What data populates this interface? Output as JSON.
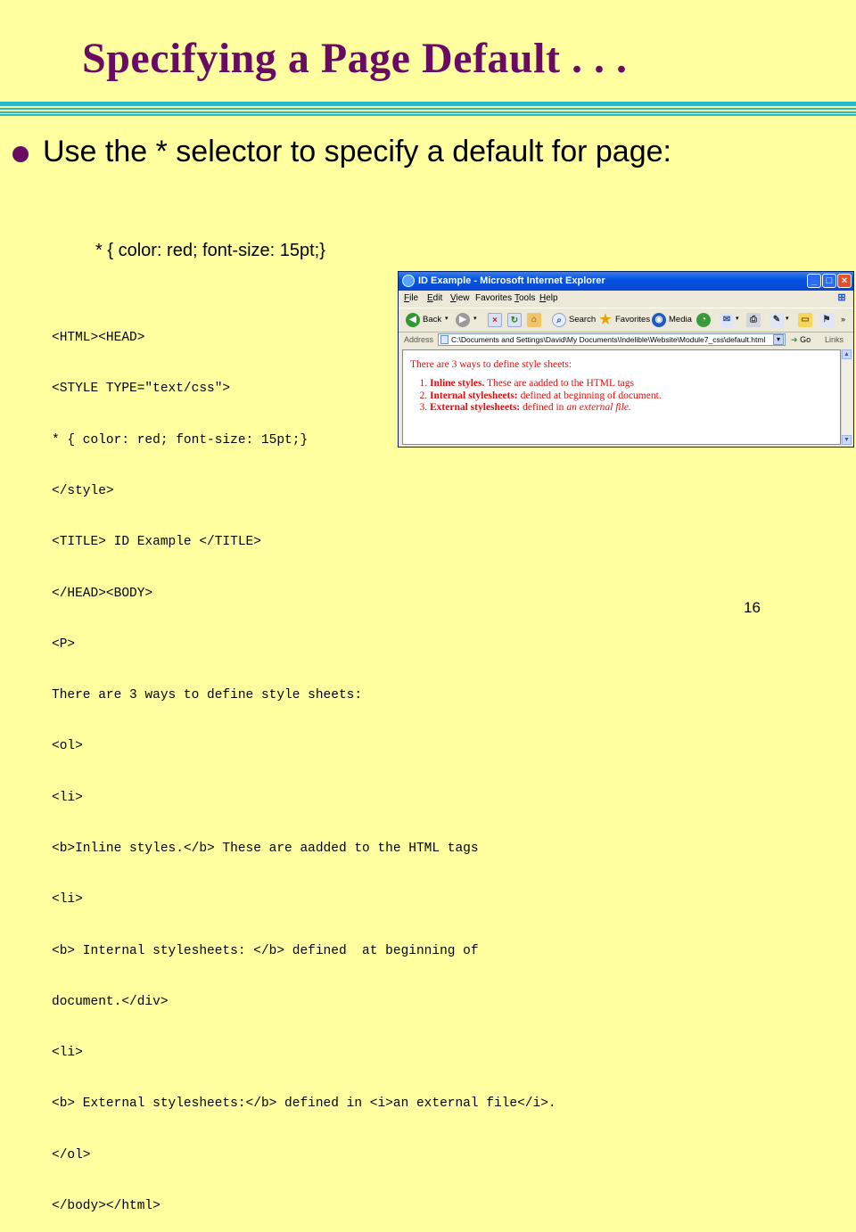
{
  "slide": {
    "title": "Specifying a Page Default . . .",
    "bullet": "Use the * selector to specify a default for page:",
    "selector_example": "* { color: red; font-size: 15pt;}",
    "code_lines": [
      "<HTML><HEAD>",
      "<STYLE TYPE=\"text/css\">",
      "* { color: red; font-size: 15pt;}",
      "</style>",
      "<TITLE> ID Example </TITLE>",
      "</HEAD><BODY>",
      "<P>",
      "There are 3 ways to define style sheets:",
      "<ol>",
      "<li>",
      "<b>Inline styles.</b> These are aadded to the HTML tags",
      "<li>",
      "<b> Internal stylesheets: </b> defined  at beginning of",
      "document.</div>",
      "<li>",
      "<b> External stylesheets:</b> defined in <i>an external file</i>.",
      "</ol>",
      "</body></html>"
    ],
    "page_number": "16"
  },
  "browser": {
    "window_title": "ID Example - Microsoft Internet Explorer",
    "menu": [
      {
        "u": "F",
        "rest": "ile"
      },
      {
        "u": "E",
        "rest": "dit"
      },
      {
        "u": "V",
        "rest": "iew"
      },
      {
        "u": "",
        "rest": "Favorites"
      },
      {
        "u": "T",
        "rest": "ools"
      },
      {
        "u": "H",
        "rest": "elp"
      }
    ],
    "toolbar": {
      "back": "Back",
      "search": "Search",
      "favorites": "Favorites",
      "media": "Media"
    },
    "address_label": "Address",
    "address_value": "C:\\Documents and Settings\\David\\My Documents\\Indelible\\Website\\Module7_css\\default.html",
    "go_label": "Go",
    "links_label": "Links",
    "content": {
      "paragraph": "There are 3 ways to define style sheets:",
      "items": [
        {
          "bold": "Inline styles.",
          "text": " These are aadded to the HTML tags",
          "italic": ""
        },
        {
          "bold": "Internal stylesheets:",
          "text": " defined at beginning of document.",
          "italic": ""
        },
        {
          "bold": "External stylesheets:",
          "text": " defined in ",
          "italic": "an external file."
        }
      ],
      "color": "#e01010"
    }
  },
  "colors": {
    "background": "#ffffa0",
    "title": "#6a0b63",
    "rule": "#2ab8c4"
  }
}
